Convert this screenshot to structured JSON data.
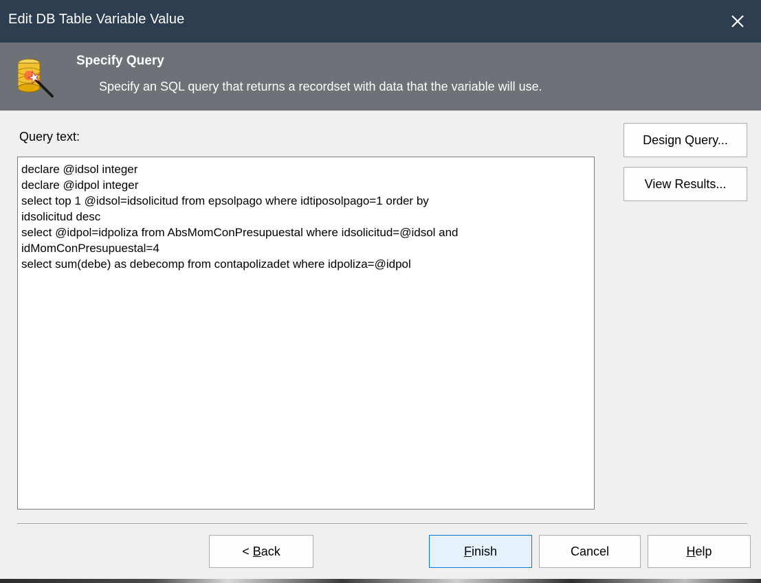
{
  "window": {
    "title": "Edit DB Table Variable Value",
    "close_icon": "close-icon"
  },
  "header": {
    "heading": "Specify Query",
    "subheading": "Specify an SQL query that returns a recordset with data that the variable will use.",
    "icon": "database-wizard-icon"
  },
  "query": {
    "label": "Query text:",
    "text": "declare @idsol integer\ndeclare @idpol integer\nselect top 1 @idsol=idsolicitud from epsolpago where idtiposolpago=1 order by\nidsolicitud desc\nselect @idpol=idpoliza from AbsMomConPresupuestal where idsolicitud=@idsol and\nidMomConPresupuestal=4\nselect sum(debe) as debecomp from contapolizadet where idpoliza=@idpol"
  },
  "side_buttons": {
    "design_query": "Design Query...",
    "view_results": "View Results..."
  },
  "footer": {
    "back_prefix": "< ",
    "back_accel": "B",
    "back_rest": "ack",
    "finish_accel": "F",
    "finish_rest": "inish",
    "cancel": "Cancel",
    "help_accel": "H",
    "help_rest": "elp"
  }
}
